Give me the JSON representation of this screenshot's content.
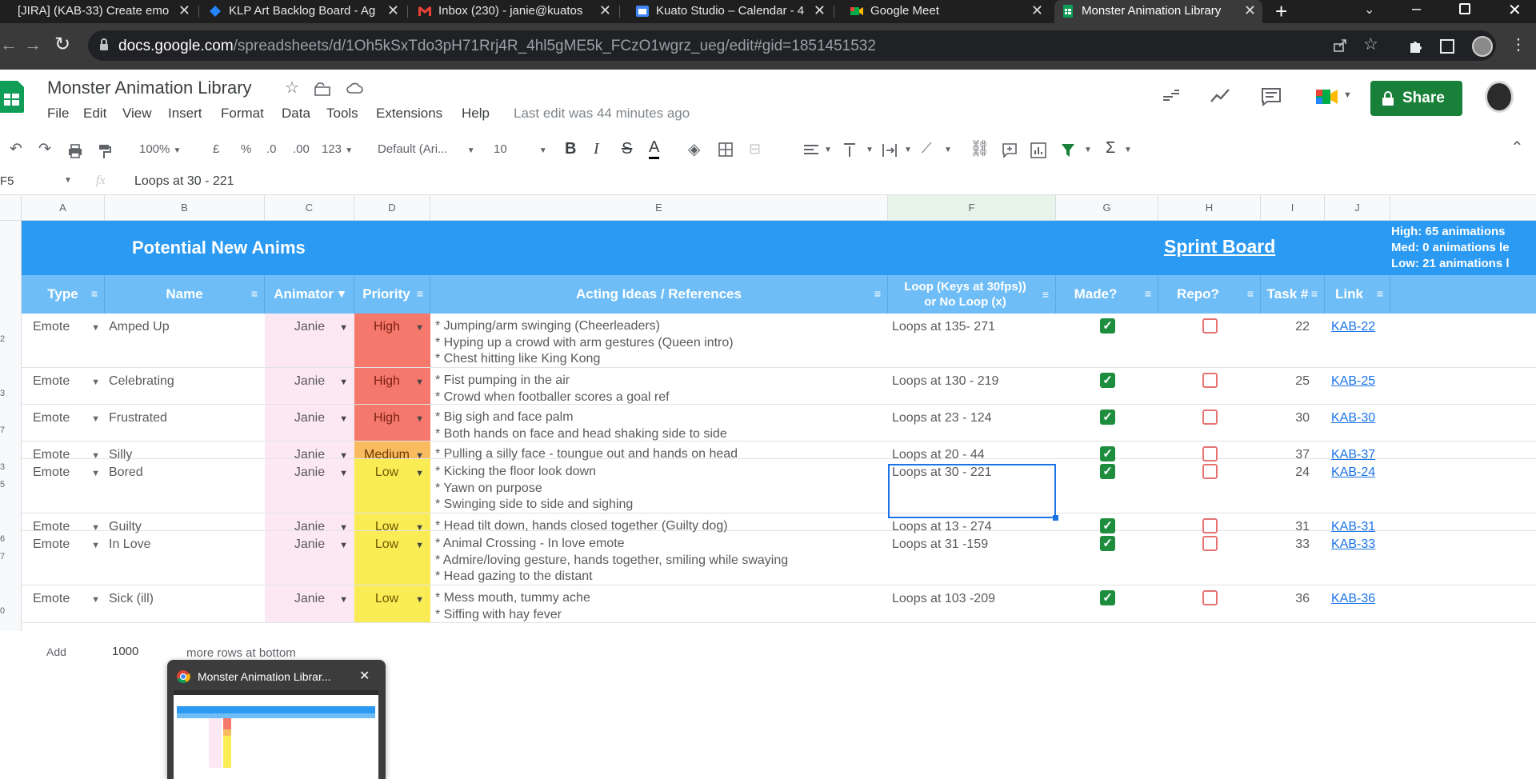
{
  "browser": {
    "tabs": [
      {
        "title": "[JIRA] (KAB-33) Create emo",
        "icon": "jira-icon"
      },
      {
        "title": "KLP Art Backlog Board - Ag",
        "icon": "jira-diamond-icon"
      },
      {
        "title": "Inbox (230) - janie@kuatos",
        "icon": "gmail-icon"
      },
      {
        "title": "Kuato Studio – Calendar - 4",
        "icon": "calendar-icon"
      },
      {
        "title": "Google Meet",
        "icon": "meet-icon"
      },
      {
        "title": "Monster Animation Library",
        "icon": "sheets-icon",
        "active": true
      }
    ],
    "url_host": "docs.google.com",
    "url_path": "/spreadsheets/d/1Oh5kSxTdo3pH71Rrj4R_4hl5gME5k_FCzO1wgrz_ueg/edit#gid=1851451532"
  },
  "doc": {
    "title": "Monster Animation Library",
    "menus": [
      "File",
      "Edit",
      "View",
      "Insert",
      "Format",
      "Data",
      "Tools",
      "Extensions",
      "Help"
    ],
    "last_edit": "Last edit was 44 minutes ago",
    "share_label": "Share"
  },
  "toolbar": {
    "zoom": "100%",
    "currency": "£",
    "percent": "%",
    "dec_less": ".0",
    "dec_more": ".00",
    "format_more": "123",
    "font": "Default (Ari...",
    "font_size": "10",
    "bold": "B",
    "italic": "I",
    "strike": "S",
    "text_color": "A",
    "sigma": "Σ"
  },
  "formula_bar": {
    "cell_ref": "F5",
    "fx": "fx",
    "content": "Loops at 30 - 221"
  },
  "columns": [
    "A",
    "B",
    "C",
    "D",
    "E",
    "F",
    "G",
    "H",
    "I",
    "J"
  ],
  "sheet": {
    "banner_left": "Potential New Anims",
    "banner_right": "Sprint Board",
    "stats": [
      "High: 65 animations",
      "Med: 0 animations le",
      "Low: 21 animations l"
    ],
    "headers": {
      "type": "Type",
      "name": "Name",
      "animator": "Animator",
      "priority": "Priority",
      "ideas": "Acting Ideas / References",
      "loop_line1": "Loop (Keys at 30fps))",
      "loop_line2": "or No Loop (x)",
      "made": "Made?",
      "repo": "Repo?",
      "task": "Task #",
      "link": "Link"
    },
    "rows": [
      {
        "rownum": "2",
        "type": "Emote",
        "name": "Amped Up",
        "animator": "Janie",
        "priority": "High",
        "ideas": [
          "* Jumping/arm swinging (Cheerleaders)",
          "* Hyping up a crowd with arm gestures (Queen intro)",
          "* Chest hitting like King Kong"
        ],
        "loop": "Loops at 135- 271",
        "made": true,
        "repo": false,
        "task": "22",
        "link": "KAB-22"
      },
      {
        "rownum": "3",
        "type": "Emote",
        "name": "Celebrating",
        "animator": "Janie",
        "priority": "High",
        "ideas": [
          "* Fist pumping in the air",
          "* Crowd when footballer scores a goal ref"
        ],
        "loop": "Loops at 130 - 219",
        "made": true,
        "repo": false,
        "task": "25",
        "link": "KAB-25"
      },
      {
        "rownum": "7",
        "type": "Emote",
        "name": "Frustrated",
        "animator": "Janie",
        "priority": "High",
        "ideas": [
          "* Big sigh and face palm",
          "* Both hands on face and head shaking side to side"
        ],
        "loop": "Loops at 23 - 124",
        "made": true,
        "repo": false,
        "task": "30",
        "link": "KAB-30"
      },
      {
        "rownum": "3",
        "type": "Emote",
        "name": "Silly",
        "animator": "Janie",
        "priority": "Medium",
        "ideas": [
          "* Pulling a silly face - toungue out and hands on head"
        ],
        "loop": "Loops at 20 - 44",
        "made": true,
        "repo": false,
        "task": "37",
        "link": "KAB-37"
      },
      {
        "rownum": "5",
        "type": "Emote",
        "name": "Bored",
        "animator": "Janie",
        "priority": "Low",
        "ideas": [
          "* Kicking the floor look down",
          "* Yawn on purpose",
          "* Swinging side to side and sighing"
        ],
        "loop": "Loops at 30 - 221",
        "made": true,
        "repo": false,
        "task": "24",
        "link": "KAB-24"
      },
      {
        "rownum": "6",
        "type": "Emote",
        "name": "Guilty",
        "animator": "Janie",
        "priority": "Low",
        "ideas": [
          "* Head tilt down, hands closed together (Guilty dog)"
        ],
        "loop": "Loops at 13 - 274",
        "made": true,
        "repo": false,
        "task": "31",
        "link": "KAB-31"
      },
      {
        "rownum": "7",
        "type": "Emote",
        "name": "In Love",
        "animator": "Janie",
        "priority": "Low",
        "ideas": [
          "* Animal Crossing - In love emote",
          "* Admire/loving gesture, hands together, smiling while swaying",
          "* Head gazing to the distant"
        ],
        "loop": "Loops at 31 -159",
        "made": true,
        "repo": false,
        "task": "33",
        "link": "KAB-33"
      },
      {
        "rownum": "0",
        "type": "Emote",
        "name": "Sick (ill)",
        "animator": "Janie",
        "priority": "Low",
        "ideas": [
          "* Mess mouth, tummy ache",
          "* Siffing with hay fever"
        ],
        "loop": "Loops at 103 -209",
        "made": true,
        "repo": false,
        "task": "36",
        "link": "KAB-36"
      }
    ],
    "add_label": "Add",
    "add_count": "1000",
    "add_suffix": "more rows at bottom"
  },
  "preview": {
    "title": "Monster Animation Librar...",
    "close": "✕"
  },
  "colors": {
    "banner": "#2b9af3",
    "header": "#6fbdf7",
    "high": "#f4786b",
    "medium": "#f9bb5f",
    "low": "#f9ec55",
    "animator_bg": "#fce8f3",
    "share": "#188038"
  }
}
